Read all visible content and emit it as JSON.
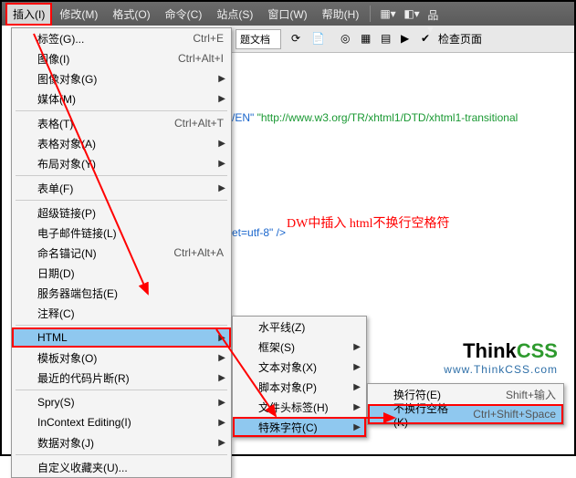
{
  "menubar": {
    "items": [
      "插入(I)",
      "修改(M)",
      "格式(O)",
      "命令(C)",
      "站点(S)",
      "窗口(W)",
      "帮助(H)"
    ]
  },
  "toolbar": {
    "doc_label": "题文档",
    "check_label": "检查页面"
  },
  "code": {
    "line1a": "/EN\" ",
    "line1b": "\"http://www.w3.org/TR/xhtml1/DTD/xhtml1-transitional",
    "line2": "et=utf-8\" />"
  },
  "annotation": "DW中插入 html不换行空格符",
  "logo": {
    "t1": "Think",
    "t2": "CSS",
    "sub": "www.ThinkCSS.com"
  },
  "menu1": [
    {
      "l": "标签(G)...",
      "s": "Ctrl+E"
    },
    {
      "l": "图像(I)",
      "s": "Ctrl+Alt+I"
    },
    {
      "l": "图像对象(G)",
      "sub": true
    },
    {
      "l": "媒体(M)",
      "sub": true
    },
    {
      "hr": true
    },
    {
      "l": "表格(T)",
      "s": "Ctrl+Alt+T"
    },
    {
      "l": "表格对象(A)",
      "sub": true
    },
    {
      "l": "布局对象(Y)",
      "sub": true
    },
    {
      "hr": true
    },
    {
      "l": "表单(F)",
      "sub": true
    },
    {
      "hr": true
    },
    {
      "l": "超级链接(P)"
    },
    {
      "l": "电子邮件链接(L)"
    },
    {
      "l": "命名锚记(N)",
      "s": "Ctrl+Alt+A"
    },
    {
      "l": "日期(D)"
    },
    {
      "l": "服务器端包括(E)"
    },
    {
      "l": "注释(C)"
    },
    {
      "hr": true
    },
    {
      "l": "HTML",
      "sub": true,
      "hl": true,
      "box": true
    },
    {
      "l": "模板对象(O)",
      "sub": true
    },
    {
      "l": "最近的代码片断(R)",
      "sub": true
    },
    {
      "hr": true
    },
    {
      "l": "Spry(S)",
      "sub": true
    },
    {
      "l": "InContext Editing(I)",
      "sub": true
    },
    {
      "l": "数据对象(J)",
      "sub": true
    },
    {
      "hr": true
    },
    {
      "l": "自定义收藏夹(U)..."
    }
  ],
  "menu2": [
    {
      "l": "水平线(Z)"
    },
    {
      "l": "框架(S)",
      "sub": true
    },
    {
      "l": "文本对象(X)",
      "sub": true
    },
    {
      "l": "脚本对象(P)",
      "sub": true
    },
    {
      "l": "文件头标签(H)",
      "sub": true
    },
    {
      "l": "特殊字符(C)",
      "sub": true,
      "hl": true,
      "box": true
    }
  ],
  "menu3": [
    {
      "l": "换行符(E)",
      "s": "Shift+输入"
    },
    {
      "l": "不换行空格(K)",
      "s": "Ctrl+Shift+Space",
      "hl": true,
      "box": true
    }
  ]
}
